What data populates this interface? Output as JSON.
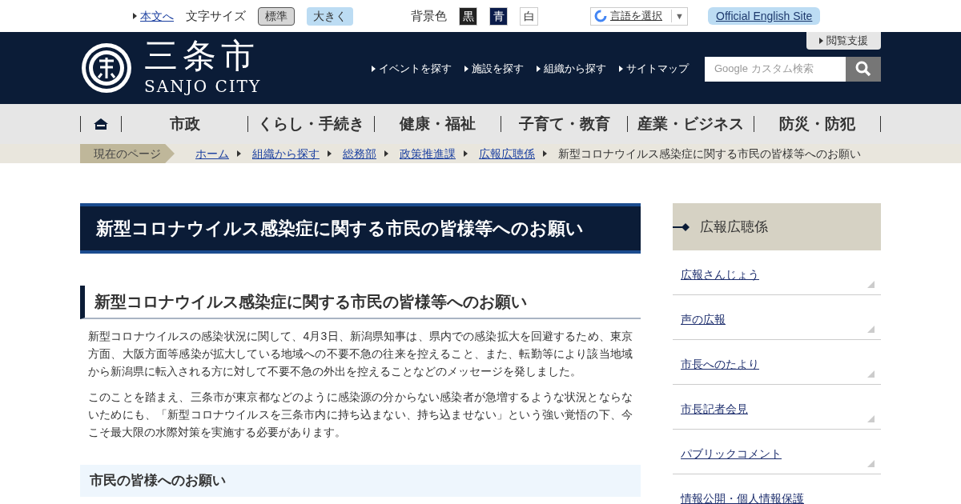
{
  "utility_bar": {
    "skip_link": "本文へ",
    "font_size_label": "文字サイズ",
    "font_sizes": [
      {
        "label": "標準",
        "selected": true
      },
      {
        "label": "大きく",
        "selected": false
      }
    ],
    "background_label": "背景色",
    "backgrounds": [
      {
        "label": "黒",
        "color": "#222222"
      },
      {
        "label": "青",
        "color": "#0b1c4a"
      },
      {
        "label": "白",
        "color": "#ffffff"
      }
    ],
    "translate": {
      "label": "言語を選択",
      "caret": "▼"
    },
    "english_link": "Official English Site"
  },
  "header": {
    "logo_title": "三条市",
    "logo_subtitle": "SANJO CITY",
    "accessibility_button": "閲覧支援",
    "links": [
      "イベントを探す",
      "施設を探す",
      "組織から探す",
      "サイトマップ"
    ],
    "search": {
      "placeholder": "Google カスタム検索"
    }
  },
  "main_nav": [
    "市政",
    "くらし・手続き",
    "健康・福祉",
    "子育て・教育",
    "産業・ビジネス",
    "防災・防犯"
  ],
  "breadcrumb": {
    "label": "現在のページ",
    "links": [
      "ホーム",
      "組織から探す",
      "総務部",
      "政策推進課",
      "広報広聴係"
    ],
    "current": "新型コロナウイルス感染症に関する市民の皆様等へのお願い"
  },
  "article": {
    "title": "新型コロナウイルス感染症に関する市民の皆様等へのお願い",
    "heading": "新型コロナウイルス感染症に関する市民の皆様等へのお願い",
    "paragraphs": [
      "新型コロナウイルスの感染状況に関して、4月3日、新潟県知事は、県内での感染拡大を回避するため、東京方面、大阪方面等感染が拡大している地域への不要不急の往来を控えること、また、転勤等により該当地域から新潟県に転入される方に対して不要不急の外出を控えることなどのメッセージを発しました。",
      "このことを踏まえ、三条市が東京都などのように感染源の分からない感染者が急増するような状況とならないためにも、「新型コロナウイルスを三条市内に持ち込まない、持ち込ませない」という強い覚悟の下、今こそ最大限の水際対策を実施する必要があります。"
    ],
    "subheading": "市民の皆様へのお願い"
  },
  "sidebar": {
    "title": "広報広聴係",
    "items": [
      "広報さんじょう",
      "声の広報",
      "市長へのたより",
      "市長記者会見",
      "パブリックコメント",
      "情報公開・個人情報保護"
    ]
  }
}
